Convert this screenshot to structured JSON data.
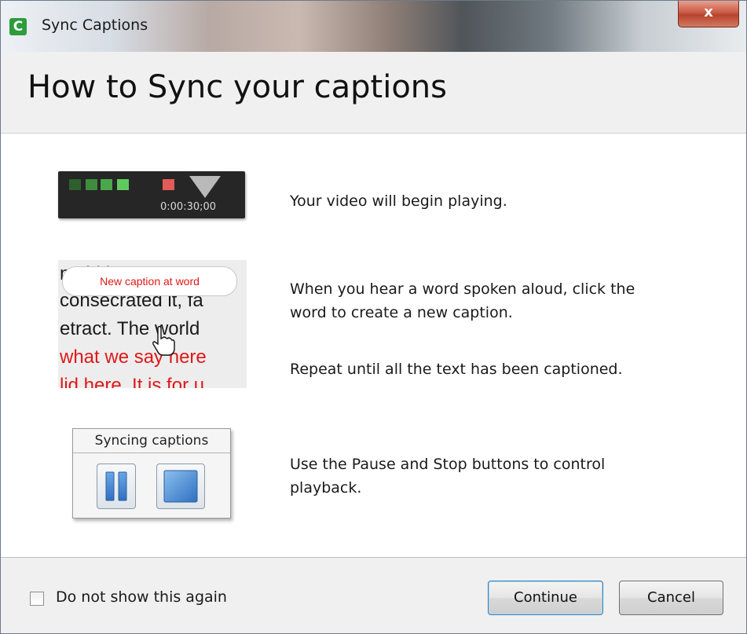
{
  "window": {
    "title": "Sync Captions",
    "app_icon_letter": "C",
    "close_glyph": "x"
  },
  "header": {
    "heading": "How to Sync your captions"
  },
  "steps": [
    {
      "icon": "timeline-illustration",
      "text": "Your video will begin playing."
    },
    {
      "icon": "click-word-illustration",
      "text_line1": "When you hear a word spoken aloud, click the",
      "text_line2": "word to create a new caption.",
      "text_extra": "Repeat until all the text has been captioned."
    },
    {
      "icon": "syncing-captions-illustration",
      "text_line1": "Use the Pause and Stop buttons to control",
      "text_line2": "playback."
    }
  ],
  "illustrations": {
    "timeline": {
      "time": "0:00:30;00",
      "marker_colors": [
        "#2f6b2f",
        "#3c8a3c",
        "#4aa84a",
        "#5cc85c",
        "#e05050"
      ]
    },
    "text_sample": {
      "bubble": "New caption at word",
      "lines": [
        "n             t       ld       le",
        "consecrated it, fa",
        "etract. The world",
        "what we say here",
        "lid here. It is for u"
      ]
    },
    "sync_panel": {
      "title": "Syncing captions",
      "pause_icon": "pause-icon",
      "stop_icon": "stop-icon"
    }
  },
  "footer": {
    "checkbox_label": "Do not show this again",
    "checkbox_checked": false,
    "continue_label": "Continue",
    "cancel_label": "Cancel"
  },
  "colors": {
    "accent_blue": "#3c7fb1",
    "caption_red": "#e01818",
    "app_green": "#2d9c3c"
  }
}
